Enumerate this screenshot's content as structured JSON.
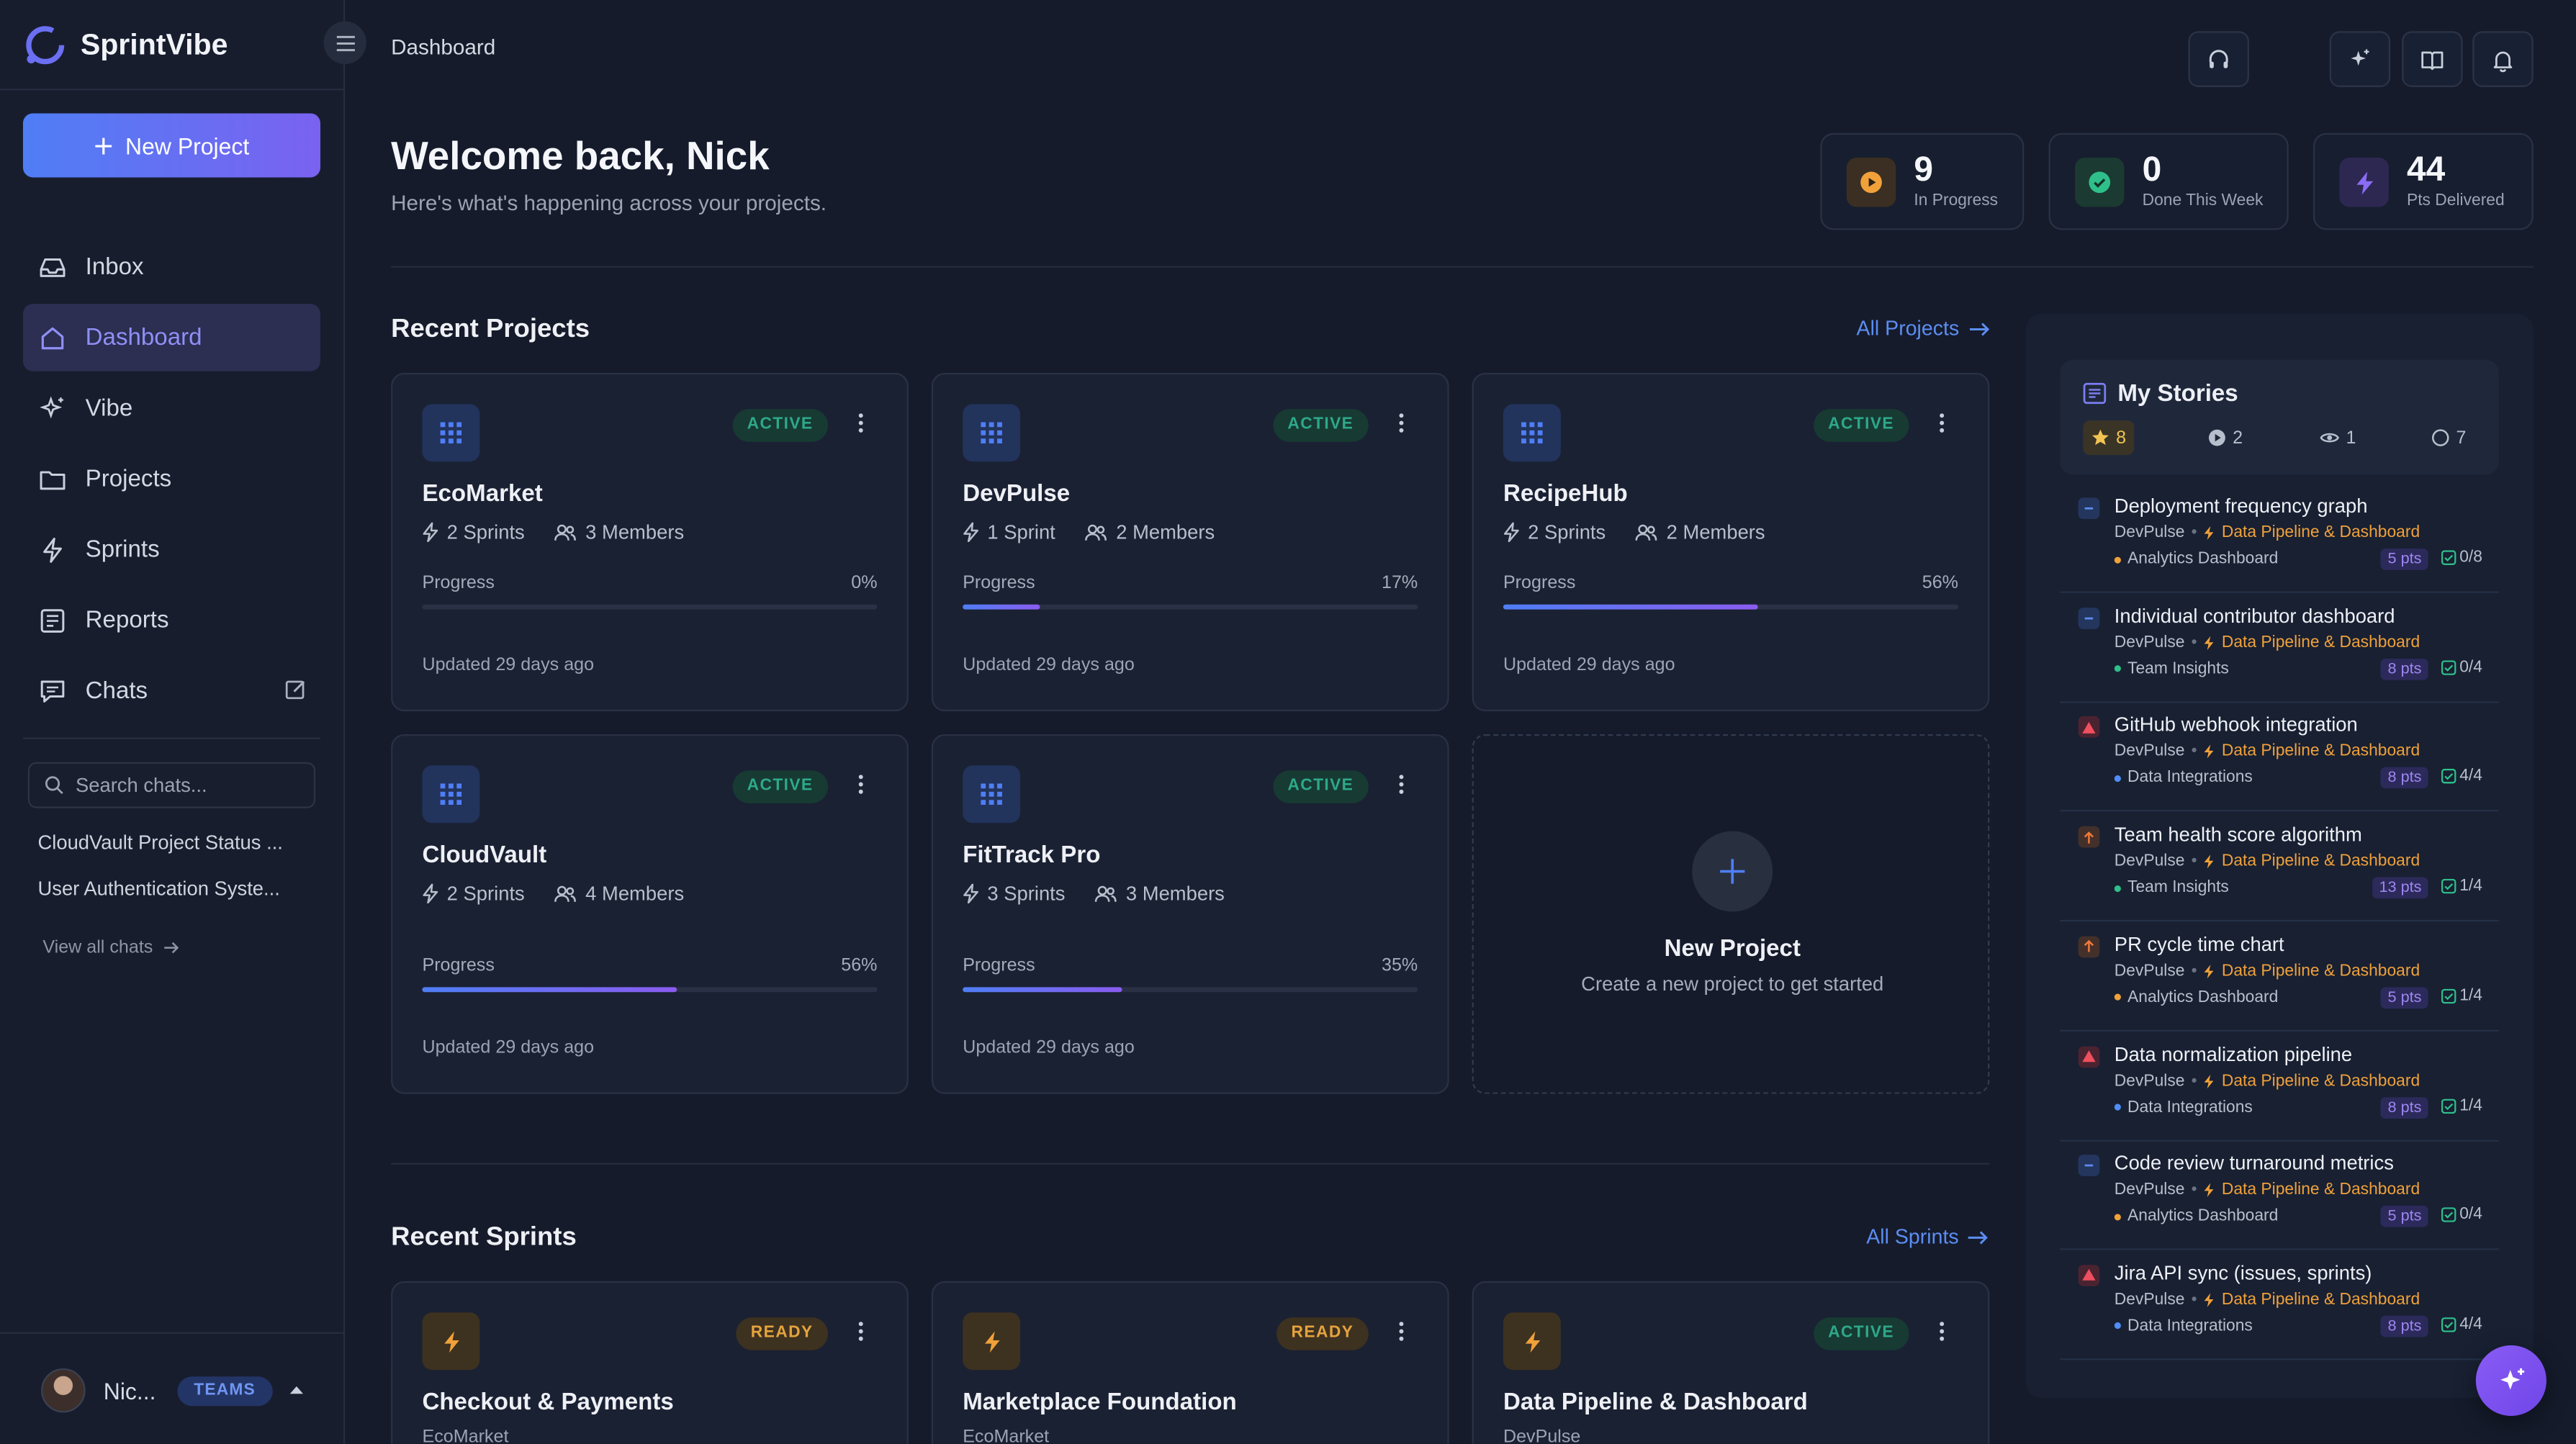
{
  "app": {
    "name": "SprintVibe",
    "new_project_label": "New Project"
  },
  "nav": {
    "items": [
      {
        "label": "Inbox"
      },
      {
        "label": "Dashboard"
      },
      {
        "label": "Vibe"
      },
      {
        "label": "Projects"
      },
      {
        "label": "Sprints"
      },
      {
        "label": "Reports"
      },
      {
        "label": "Chats"
      }
    ],
    "active": "Dashboard"
  },
  "chats": {
    "search_placeholder": "Search chats...",
    "recent": [
      "CloudVault Project Status ...",
      "User Authentication Syste..."
    ],
    "view_all_label": "View all chats"
  },
  "user": {
    "name": "Nic...",
    "badge": "TEAMS"
  },
  "header": {
    "breadcrumb": "Dashboard"
  },
  "welcome": {
    "title": "Welcome back, Nick",
    "subtitle": "Here's what's happening across your projects."
  },
  "stats": [
    {
      "value": "9",
      "label": "In Progress",
      "color": "#f0a13a"
    },
    {
      "value": "0",
      "label": "Done This Week",
      "color": "#2fbf8a"
    },
    {
      "value": "44",
      "label": "Pts Delivered",
      "color": "#8b6cf5"
    }
  ],
  "recent_projects": {
    "title": "Recent Projects",
    "link_label": "All Projects",
    "progress_label": "Progress",
    "items": [
      {
        "name": "EcoMarket",
        "status": "ACTIVE",
        "sprints": "2 Sprints",
        "members": "3 Members",
        "progress": 0,
        "progress_text": "0%",
        "updated": "Updated 29 days ago"
      },
      {
        "name": "DevPulse",
        "status": "ACTIVE",
        "sprints": "1 Sprint",
        "members": "2 Members",
        "progress": 17,
        "progress_text": "17%",
        "updated": "Updated 29 days ago"
      },
      {
        "name": "RecipeHub",
        "status": "ACTIVE",
        "sprints": "2 Sprints",
        "members": "2 Members",
        "progress": 56,
        "progress_text": "56%",
        "updated": "Updated 29 days ago"
      },
      {
        "name": "CloudVault",
        "status": "ACTIVE",
        "sprints": "2 Sprints",
        "members": "4 Members",
        "progress": 56,
        "progress_text": "56%",
        "updated": "Updated 29 days ago"
      },
      {
        "name": "FitTrack Pro",
        "status": "ACTIVE",
        "sprints": "3 Sprints",
        "members": "3 Members",
        "progress": 35,
        "progress_text": "35%",
        "updated": "Updated 29 days ago"
      }
    ],
    "new_card": {
      "title": "New Project",
      "subtitle": "Create a new project to get started"
    }
  },
  "recent_sprints": {
    "title": "Recent Sprints",
    "link_label": "All Sprints",
    "items": [
      {
        "name": "Checkout & Payments",
        "status": "READY",
        "project": "EcoMarket"
      },
      {
        "name": "Marketplace Foundation",
        "status": "READY",
        "project": "EcoMarket"
      },
      {
        "name": "Data Pipeline & Dashboard",
        "status": "ACTIVE",
        "project": "DevPulse"
      }
    ]
  },
  "my_stories": {
    "title": "My Stories",
    "filters": [
      {
        "icon": "star-icon",
        "count": "8"
      },
      {
        "icon": "play-icon",
        "count": "2"
      },
      {
        "icon": "eye-icon",
        "count": "1"
      },
      {
        "icon": "circle-icon",
        "count": "7"
      }
    ],
    "items": [
      {
        "title": "Deployment frequency graph",
        "priority": "low",
        "project": "DevPulse",
        "sprint": "Data Pipeline & Dashboard",
        "epic": "Analytics Dashboard",
        "epic_color": "#f0a13a",
        "points": "5 pts",
        "tasks": "0/8"
      },
      {
        "title": "Individual contributor dashboard",
        "priority": "low",
        "project": "DevPulse",
        "sprint": "Data Pipeline & Dashboard",
        "epic": "Team Insights",
        "epic_color": "#2fbf8a",
        "points": "8 pts",
        "tasks": "0/4"
      },
      {
        "title": "GitHub webhook integration",
        "priority": "urgent",
        "project": "DevPulse",
        "sprint": "Data Pipeline & Dashboard",
        "epic": "Data Integrations",
        "epic_color": "#4f8ef5",
        "points": "8 pts",
        "tasks": "4/4"
      },
      {
        "title": "Team health score algorithm",
        "priority": "high",
        "project": "DevPulse",
        "sprint": "Data Pipeline & Dashboard",
        "epic": "Team Insights",
        "epic_color": "#2fbf8a",
        "points": "13 pts",
        "tasks": "1/4"
      },
      {
        "title": "PR cycle time chart",
        "priority": "high",
        "project": "DevPulse",
        "sprint": "Data Pipeline & Dashboard",
        "epic": "Analytics Dashboard",
        "epic_color": "#f0a13a",
        "points": "5 pts",
        "tasks": "1/4"
      },
      {
        "title": "Data normalization pipeline",
        "priority": "urgent",
        "project": "DevPulse",
        "sprint": "Data Pipeline & Dashboard",
        "epic": "Data Integrations",
        "epic_color": "#4f8ef5",
        "points": "8 pts",
        "tasks": "1/4"
      },
      {
        "title": "Code review turnaround metrics",
        "priority": "low",
        "project": "DevPulse",
        "sprint": "Data Pipeline & Dashboard",
        "epic": "Analytics Dashboard",
        "epic_color": "#f0a13a",
        "points": "5 pts",
        "tasks": "0/4"
      },
      {
        "title": "Jira API sync (issues, sprints)",
        "priority": "urgent",
        "project": "DevPulse",
        "sprint": "Data Pipeline & Dashboard",
        "epic": "Data Integrations",
        "epic_color": "#4f8ef5",
        "points": "8 pts",
        "tasks": "4/4"
      }
    ]
  }
}
